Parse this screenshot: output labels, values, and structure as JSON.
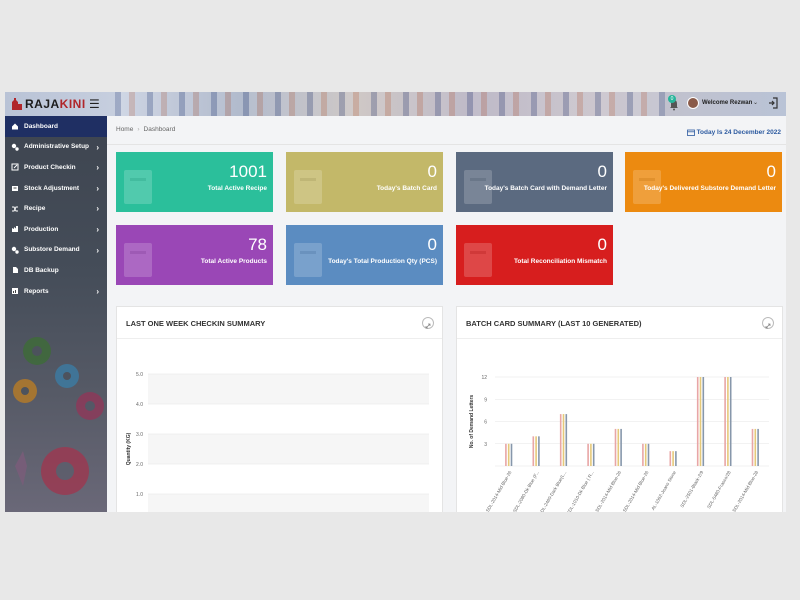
{
  "header": {
    "brand_prefix": "RAJA",
    "brand_suffix": "KINI",
    "notification_count": "0",
    "welcome": "Welcome Rezwan"
  },
  "sidebar": {
    "items": [
      {
        "label": "Dashboard",
        "icon": "home-icon",
        "has_submenu": false
      },
      {
        "label": "Administrative Setup",
        "icon": "cogs-icon",
        "has_submenu": true
      },
      {
        "label": "Product Checkin",
        "icon": "edit-icon",
        "has_submenu": true
      },
      {
        "label": "Stock Adjustment",
        "icon": "box-icon",
        "has_submenu": true
      },
      {
        "label": "Recipe",
        "icon": "shuffle-icon",
        "has_submenu": true
      },
      {
        "label": "Production",
        "icon": "factory-icon",
        "has_submenu": true
      },
      {
        "label": "Substore Demand",
        "icon": "cogs-icon",
        "has_submenu": true
      },
      {
        "label": "DB Backup",
        "icon": "file-icon",
        "has_submenu": false
      },
      {
        "label": "Reports",
        "icon": "report-icon",
        "has_submenu": true
      }
    ]
  },
  "breadcrumb": {
    "home": "Home",
    "current": "Dashboard"
  },
  "today": "Today Is 24 December 2022",
  "stats": [
    {
      "value": "1001",
      "label": "Total Active Recipe",
      "color": "#2bbf9b"
    },
    {
      "value": "0",
      "label": "Today's Batch Card",
      "color": "#c3b869"
    },
    {
      "value": "0",
      "label": "Today's Batch Card with Demand Letter",
      "color": "#5b6a80"
    },
    {
      "value": "0",
      "label": "Today's Delivered Substore Demand Letter",
      "color": "#ec8a10"
    },
    {
      "value": "78",
      "label": "Total Active Products",
      "color": "#9a47b6"
    },
    {
      "value": "0",
      "label": "Today's Total Production Qty (PCS)",
      "color": "#5b8cc1"
    },
    {
      "value": "0",
      "label": "Total Reconciliation Mismatch",
      "color": "#d71e1e"
    }
  ],
  "panels": {
    "checkin_title": "LAST ONE WEEK CHECKIN SUMMARY",
    "batch_title": "BATCH CARD SUMMARY (LAST 10 GENERATED)"
  },
  "chart_data": [
    {
      "type": "line",
      "title": "LAST ONE WEEK CHECKIN SUMMARY",
      "ylabel": "Quantity (KG)",
      "yticks": [
        "5.0",
        "4.0",
        "3.0",
        "2.0",
        "1.0"
      ],
      "ylim": [
        0,
        5
      ],
      "grid": true
    },
    {
      "type": "bar",
      "title": "BATCH CARD SUMMARY (LAST 10 GENERATED)",
      "ylabel": "No. of Demand Letters",
      "yticks": [
        "12",
        "9",
        "6",
        "3"
      ],
      "ylim": [
        0,
        12
      ],
      "categories": [
        "SDL-2014-Mid Blue-26",
        "SDL-2080-Dk Blue (F...",
        "SDL-2460-Dark Blue(L...",
        "SDL-1010-Dk Blue ( R...",
        "SDL-2014-Mid Blue-26",
        "SDL-2014-Mid Blue-26",
        "AL-1062-Jeans Stone",
        "SDL-2501-Black-2/9",
        "SDL-5480-Frasco/28",
        "SDL-2014-Mid Blue-28"
      ],
      "series": [
        {
          "values": [
            3,
            4,
            7,
            3,
            5,
            3,
            2,
            12,
            12,
            5
          ],
          "color": "#e8a6a6"
        },
        {
          "values": [
            3,
            4,
            7,
            3,
            5,
            3,
            2,
            12,
            12,
            5
          ],
          "color": "#e5c97a"
        },
        {
          "values": [
            3,
            4,
            7,
            3,
            5,
            3,
            2,
            12,
            12,
            5
          ],
          "color": "#8797ab"
        }
      ]
    }
  ]
}
